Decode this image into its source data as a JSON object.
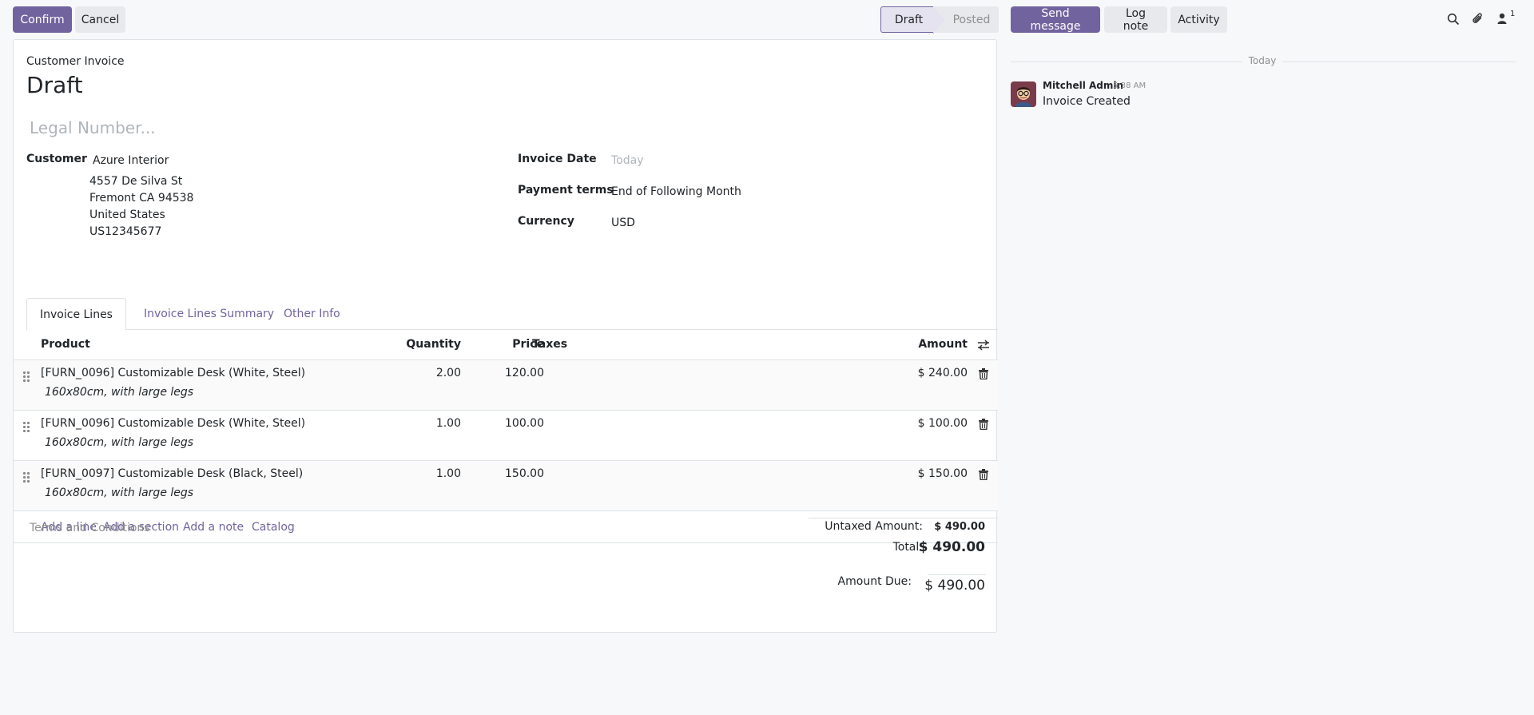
{
  "control": {
    "confirm": "Confirm",
    "cancel": "Cancel"
  },
  "statusbar": {
    "stages": [
      "Draft",
      "Posted"
    ],
    "current": "Draft"
  },
  "chatter": {
    "send_message": "Send message",
    "log_note": "Log note",
    "activity": "Activity",
    "followers_count": "1",
    "date_separator": "Today",
    "messages": [
      {
        "author": "Mitchell Admin",
        "time": "5:38 AM",
        "body": "Invoice Created"
      }
    ]
  },
  "form": {
    "type_label": "Customer Invoice",
    "state_title": "Draft",
    "legal_number_placeholder": "Legal Number...",
    "customer_label": "Customer",
    "customer_name": "Azure Interior",
    "customer_address": [
      "4557 De Silva St",
      "Fremont CA 94538",
      "United States",
      "US12345677"
    ],
    "invoice_date_label": "Invoice Date",
    "invoice_date_placeholder": "Today",
    "payment_terms_label": "Payment terms",
    "payment_terms_value": "End of Following Month",
    "currency_label": "Currency",
    "currency_value": "USD"
  },
  "tabs": [
    "Invoice Lines",
    "Invoice Lines Summary",
    "Other Info"
  ],
  "lines": {
    "headers": {
      "product": "Product",
      "quantity": "Quantity",
      "price": "Price",
      "taxes": "Taxes",
      "amount": "Amount"
    },
    "rows": [
      {
        "product": "[FURN_0096] Customizable Desk (White, Steel)",
        "description": "160x80cm, with large legs",
        "quantity": "2.00",
        "price": "120.00",
        "amount": "$ 240.00"
      },
      {
        "product": "[FURN_0096] Customizable Desk (White, Steel)",
        "description": "160x80cm, with large legs",
        "quantity": "1.00",
        "price": "100.00",
        "amount": "$ 100.00"
      },
      {
        "product": "[FURN_0097] Customizable Desk (Black, Steel)",
        "description": "160x80cm, with large legs",
        "quantity": "1.00",
        "price": "150.00",
        "amount": "$ 150.00"
      }
    ],
    "add_links": [
      "Add a line",
      "Add a section",
      "Add a note",
      "Catalog"
    ]
  },
  "footer": {
    "terms_placeholder": "Terms and Conditions",
    "untaxed_label": "Untaxed Amount:",
    "untaxed_value": "$ 490.00",
    "total_label": "Total:",
    "total_value": "$ 490.00",
    "amount_due_label": "Amount Due:",
    "amount_due_value": "$ 490.00"
  },
  "colors": {
    "primary": "#71639e",
    "secondary_bg": "#e7e9ed",
    "page_bg": "#f7f8fa",
    "link": "#71639e"
  }
}
